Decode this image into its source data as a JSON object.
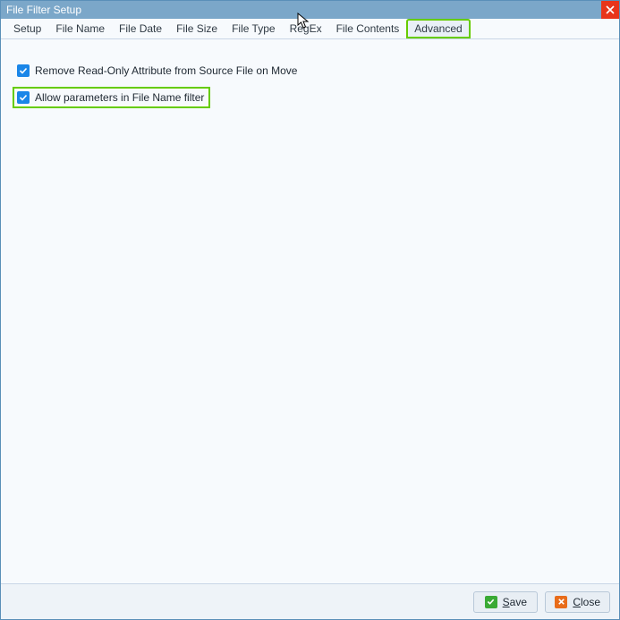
{
  "window": {
    "title": "File Filter Setup"
  },
  "tabs": [
    {
      "label": "Setup"
    },
    {
      "label": "File Name"
    },
    {
      "label": "File Date"
    },
    {
      "label": "File Size"
    },
    {
      "label": "File Type"
    },
    {
      "label": "RegEx"
    },
    {
      "label": "File Contents"
    },
    {
      "label": "Advanced"
    }
  ],
  "options": {
    "remove_readonly": {
      "label": "Remove Read-Only Attribute from Source File on Move",
      "checked": true
    },
    "allow_params": {
      "label": "Allow parameters in File Name filter",
      "checked": true
    }
  },
  "buttons": {
    "save": {
      "u": "S",
      "rest": "ave"
    },
    "close": {
      "u": "C",
      "rest": "lose"
    }
  }
}
